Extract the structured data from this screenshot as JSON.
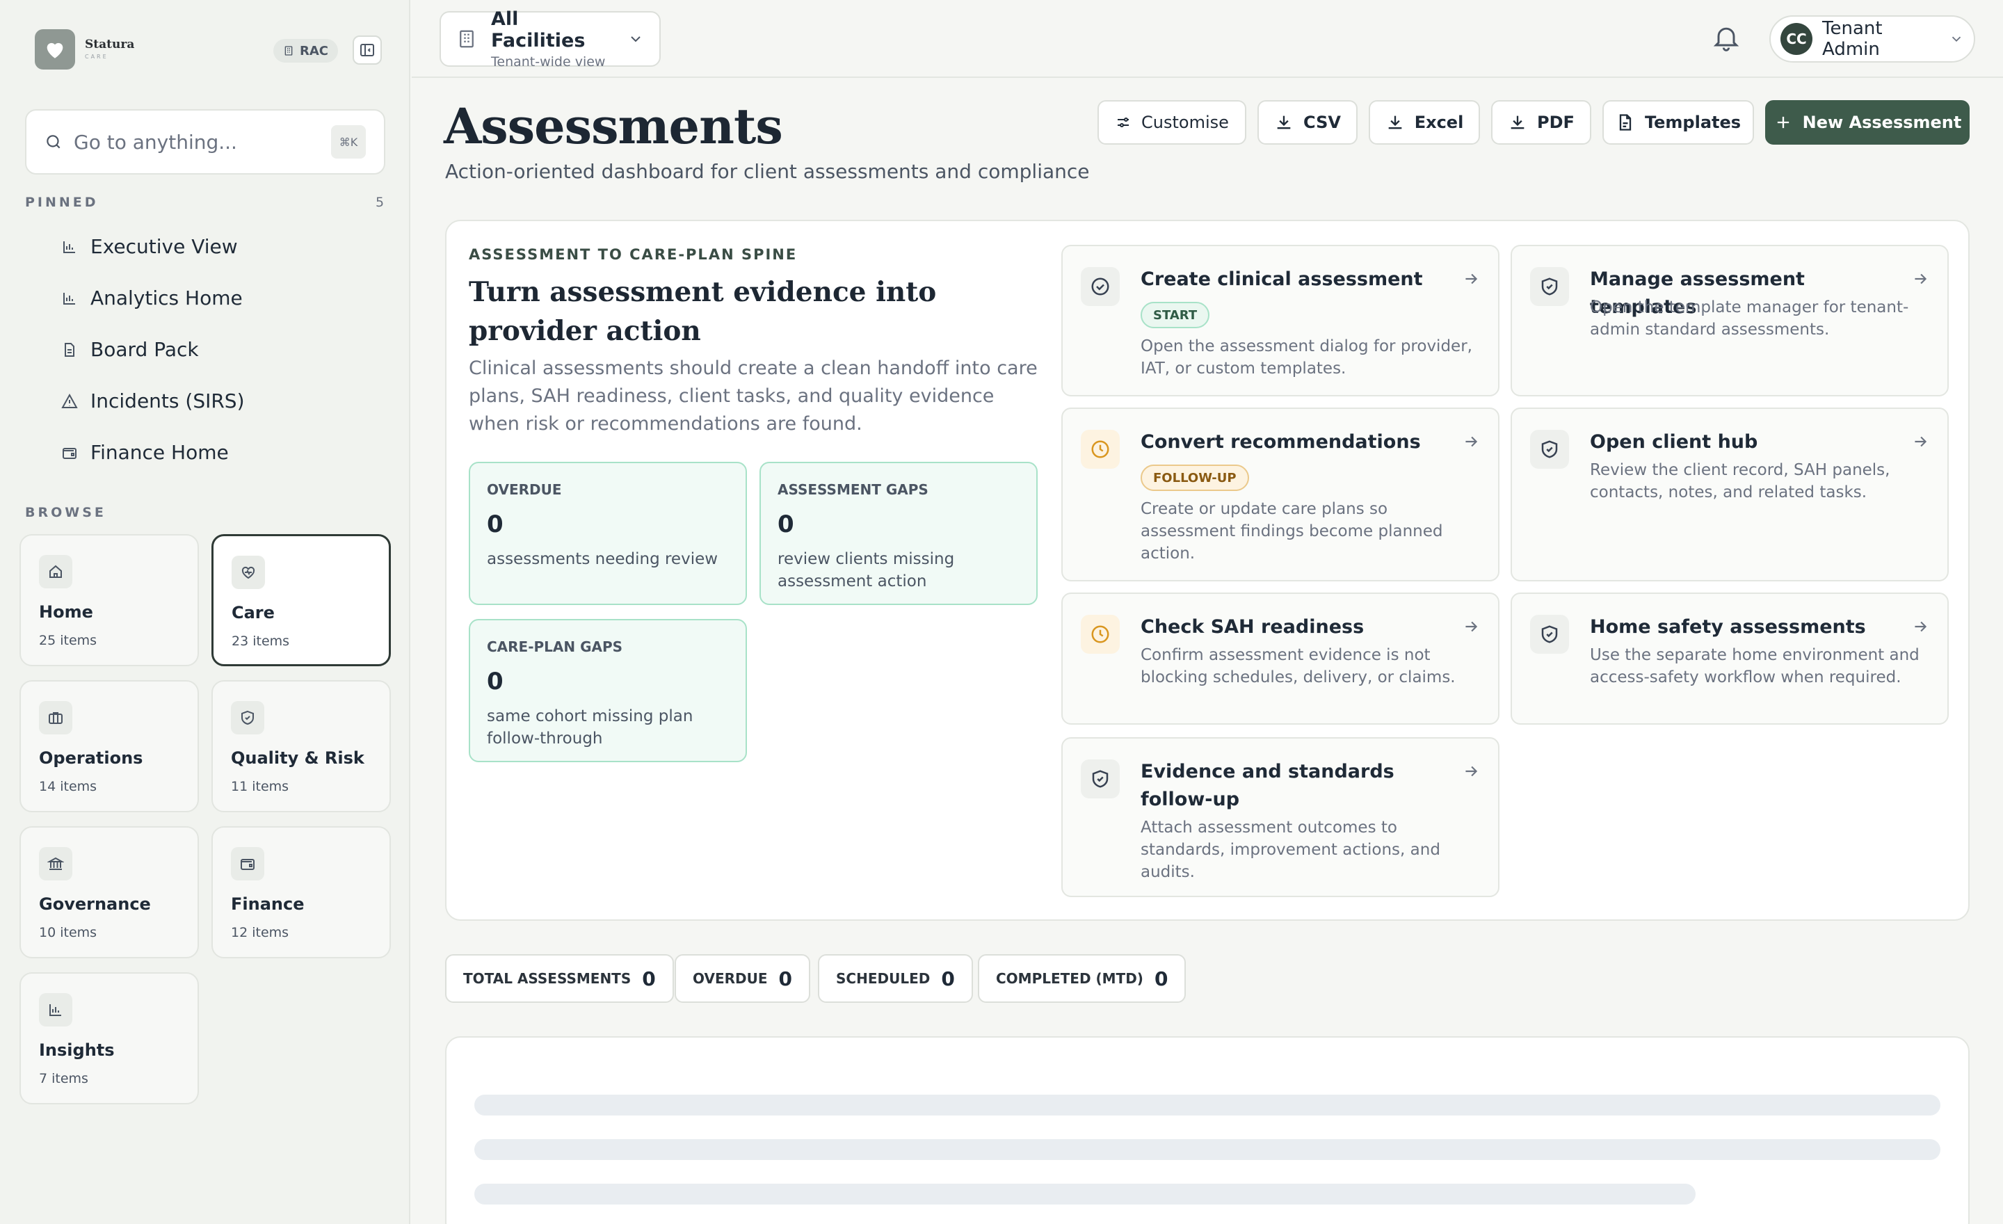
{
  "brand": {
    "name": "Statura",
    "sub": "CARE",
    "badge": "RAC"
  },
  "search": {
    "placeholder": "Go to anything...",
    "shortcut": "⌘K"
  },
  "pinned": {
    "label": "PINNED",
    "count": "5",
    "items": [
      {
        "label": "Executive View",
        "icon": "bar-chart-icon"
      },
      {
        "label": "Analytics Home",
        "icon": "bar-chart-icon"
      },
      {
        "label": "Board Pack",
        "icon": "document-icon"
      },
      {
        "label": "Incidents (SIRS)",
        "icon": "warning-icon"
      },
      {
        "label": "Finance Home",
        "icon": "wallet-icon"
      }
    ]
  },
  "browse": {
    "label": "BROWSE",
    "cards": [
      {
        "title": "Home",
        "count": "25 items",
        "icon": "home-icon"
      },
      {
        "title": "Care",
        "count": "23 items",
        "icon": "heart-pulse-icon",
        "active": true
      },
      {
        "title": "Operations",
        "count": "14 items",
        "icon": "briefcase-icon"
      },
      {
        "title": "Quality & Risk",
        "count": "11 items",
        "icon": "shield-check-icon"
      },
      {
        "title": "Governance",
        "count": "10 items",
        "icon": "bank-icon"
      },
      {
        "title": "Finance",
        "count": "12 items",
        "icon": "wallet-icon"
      },
      {
        "title": "Insights",
        "count": "7 items",
        "icon": "bar-chart-icon"
      }
    ]
  },
  "topbar": {
    "facility_title": "All Facilities",
    "facility_sub": "Tenant-wide view",
    "user_initials": "CC",
    "user_name": "Tenant Admin"
  },
  "header": {
    "title": "Assessments",
    "subtitle": "Action-oriented dashboard for client assessments and compliance",
    "buttons": {
      "customise": "Customise",
      "csv": "CSV",
      "excel": "Excel",
      "pdf": "PDF",
      "templates": "Templates",
      "new": "New Assessment"
    }
  },
  "spine": {
    "eyebrow": "ASSESSMENT TO CARE-PLAN SPINE",
    "title": "Turn assessment evidence into provider action",
    "description": "Clinical assessments should create a clean handoff into care plans, SAH readiness, client tasks, and quality evidence when risk or recommendations are found.",
    "metrics": [
      {
        "label": "OVERDUE",
        "value": "0",
        "desc": "assessments needing review"
      },
      {
        "label": "ASSESSMENT GAPS",
        "value": "0",
        "desc": "review clients missing assessment action"
      },
      {
        "label": "CARE-PLAN GAPS",
        "value": "0",
        "desc": "same cohort missing plan follow-through"
      }
    ],
    "actions": [
      {
        "title": "Create clinical assessment",
        "tag": "START",
        "desc": "Open the assessment dialog for provider, IAT, or custom templates."
      },
      {
        "title": "Manage assessment templates",
        "desc": "Open the template manager for tenant-admin standard assessments."
      },
      {
        "title": "Convert recommendations",
        "tag": "FOLLOW-UP",
        "desc": "Create or update care plans so assessment findings become planned action."
      },
      {
        "title": "Open client hub",
        "desc": "Review the client record, SAH panels, contacts, notes, and related tasks."
      },
      {
        "title": "Check SAH readiness",
        "desc": "Confirm assessment evidence is not blocking schedules, delivery, or claims."
      },
      {
        "title": "Home safety assessments",
        "desc": "Use the separate home environment and access-safety workflow when required."
      },
      {
        "title": "Evidence and standards follow-up",
        "desc": "Attach assessment outcomes to standards, improvement actions, and audits."
      }
    ]
  },
  "stats": [
    {
      "label": "TOTAL ASSESSMENTS",
      "value": "0"
    },
    {
      "label": "OVERDUE",
      "value": "0"
    },
    {
      "label": "SCHEDULED",
      "value": "0"
    },
    {
      "label": "COMPLETED (MTD)",
      "value": "0"
    }
  ],
  "colors": {
    "accent": "#3e5b4b",
    "mint_bg": "#f1faf6",
    "mint_border": "#a8e2c8",
    "amber": "#d9961f"
  }
}
